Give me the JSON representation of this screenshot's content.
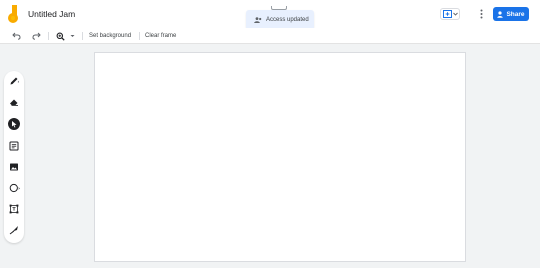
{
  "app": {
    "title": "Untitled Jam"
  },
  "toast": {
    "text": "Access updated"
  },
  "header": {
    "share_label": "Share"
  },
  "toolbar": {
    "undo_icon": "undo-icon",
    "redo_icon": "redo-icon",
    "zoom_icon": "zoom-icon",
    "set_background_label": "Set background",
    "clear_frame_label": "Clear frame"
  },
  "tools": [
    "pen-icon",
    "eraser-icon",
    "select-icon",
    "sticky-note-icon",
    "image-icon",
    "circle-icon",
    "text-box-icon",
    "laser-icon"
  ],
  "colors": {
    "accent": "#1a73e8",
    "toast_bg": "#e8f0fe",
    "active_tool": "#202124"
  }
}
